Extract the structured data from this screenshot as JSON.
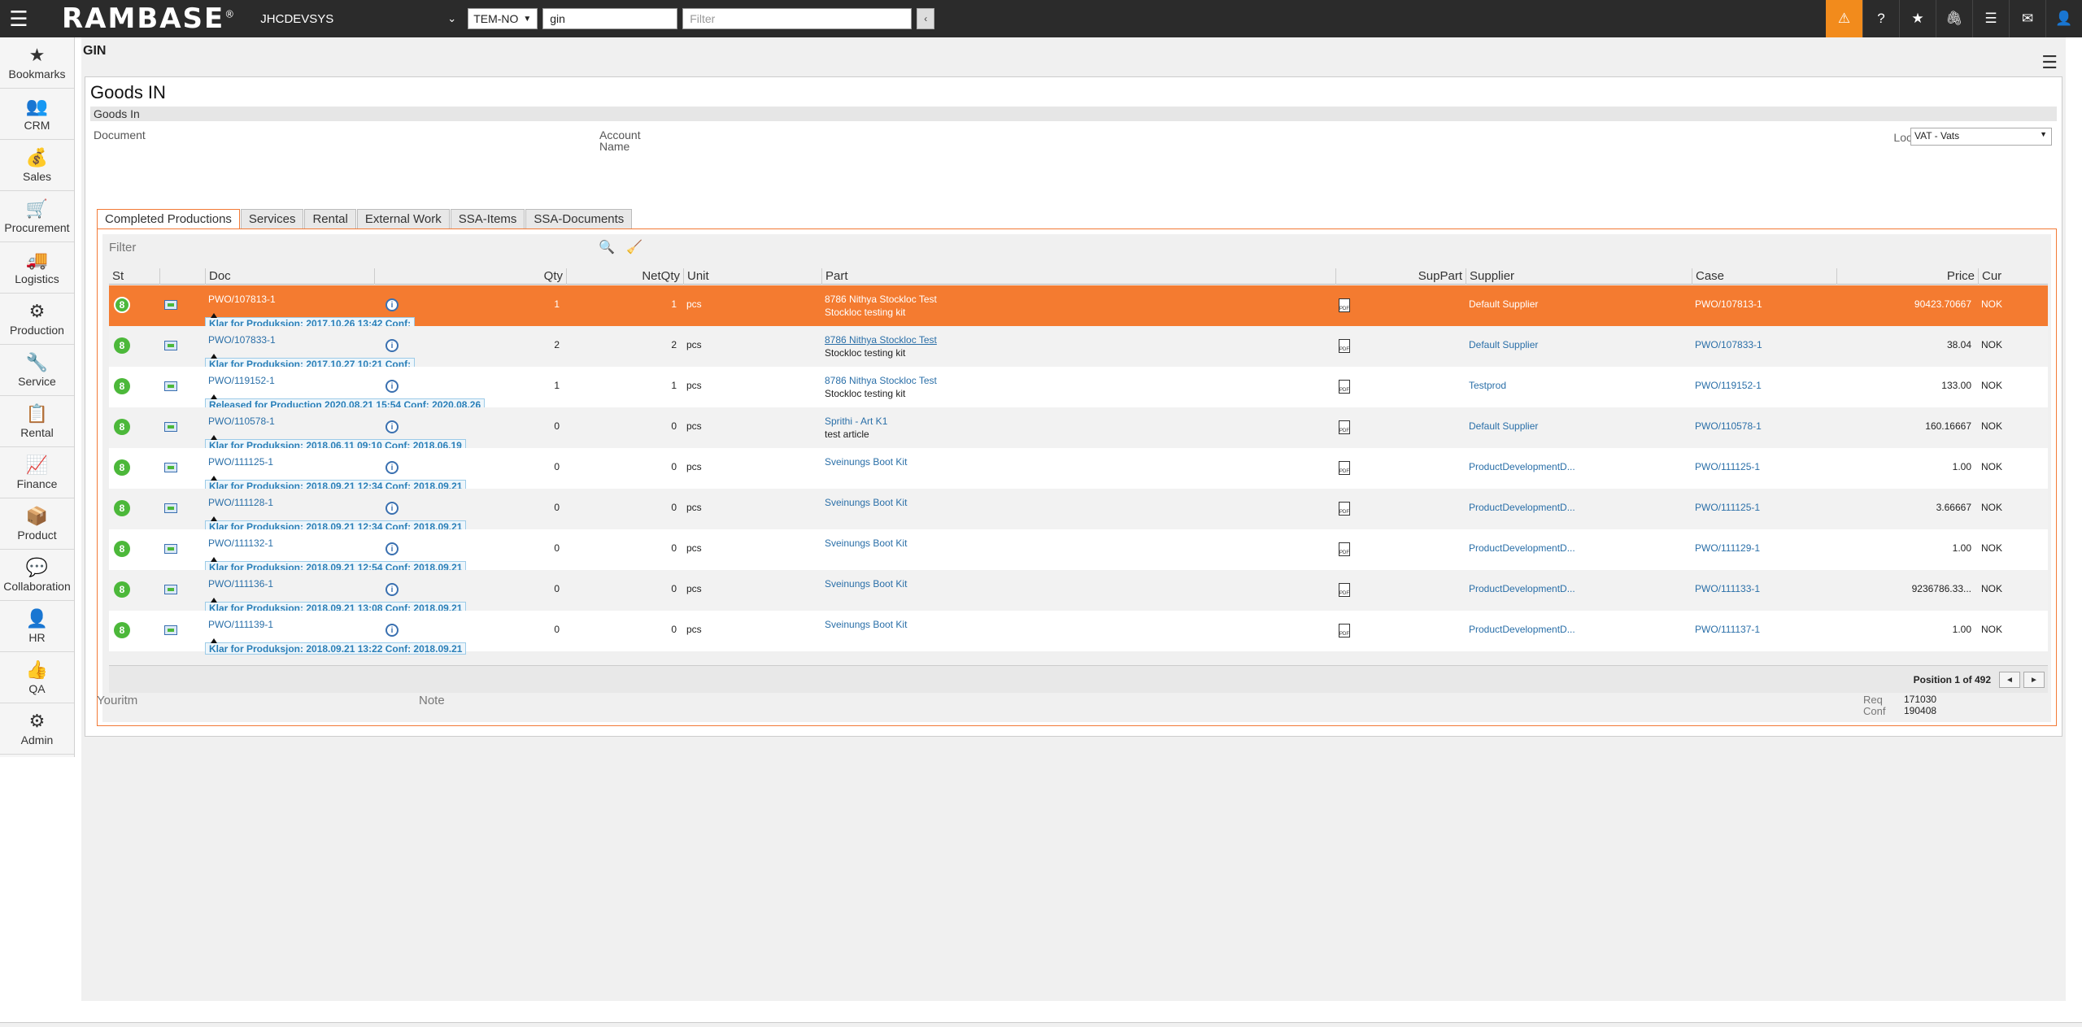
{
  "topbar": {
    "logo": "RAMBASE",
    "logo_mark": "®",
    "company": "JHCDEVSYS",
    "company_arrow": "⌄",
    "company_code": "TEM-NO",
    "program_value": "gin",
    "filter_placeholder": "Filter",
    "collapse_btn": "‹",
    "icons": [
      "warning-icon",
      "help-icon",
      "star-icon",
      "paperclip-icon",
      "list-icon",
      "mail-icon",
      "user-icon"
    ]
  },
  "sidebar": {
    "items": [
      {
        "label": "Bookmarks",
        "icon": "★"
      },
      {
        "label": "CRM",
        "icon": "👥"
      },
      {
        "label": "Sales",
        "icon": "💰"
      },
      {
        "label": "Procurement",
        "icon": "🛒"
      },
      {
        "label": "Logistics",
        "icon": "🚚"
      },
      {
        "label": "Production",
        "icon": "⚙"
      },
      {
        "label": "Service",
        "icon": "🔧"
      },
      {
        "label": "Rental",
        "icon": "📋"
      },
      {
        "label": "Finance",
        "icon": "📈"
      },
      {
        "label": "Product",
        "icon": "📦"
      },
      {
        "label": "Collaboration",
        "icon": "💬"
      },
      {
        "label": "HR",
        "icon": "👤"
      },
      {
        "label": "QA",
        "icon": "👍"
      },
      {
        "label": "Admin",
        "icon": "⚙"
      }
    ]
  },
  "page": {
    "title": "GIN",
    "card_title": "Goods IN",
    "section": "Goods In",
    "fields": {
      "document": "Document",
      "account_name_1": "Account",
      "account_name_2": "Name",
      "loc_label": "Loc",
      "loc_value": "VAT - Vats"
    }
  },
  "tabs": [
    "Completed Productions",
    "Services",
    "Rental",
    "External Work",
    "SSA-Items",
    "SSA-Documents"
  ],
  "grid": {
    "filter_label": "Filter",
    "columns": {
      "st": "St",
      "doc": "Doc",
      "qty": "Qty",
      "netqty": "NetQty",
      "unit": "Unit",
      "part": "Part",
      "suppart": "SupPart",
      "supplier": "Supplier",
      "case": "Case",
      "price": "Price",
      "cur": "Cur"
    },
    "rows": [
      {
        "st": "8",
        "doc": "PWO/107813-1",
        "status": "Klar for Produksjon: 2017.10.26 13:42 Conf:",
        "qty": "1",
        "netqty": "1",
        "unit": "pcs",
        "part1": "8786 Nithya Stockloc Test",
        "part2": "Stockloc testing kit",
        "supplier": "Default Supplier",
        "case": "PWO/107813-1",
        "price": "90423.70667",
        "cur": "NOK"
      },
      {
        "st": "8",
        "doc": "PWO/107833-1",
        "status": "Klar for Produksjon: 2017.10.27 10:21 Conf:",
        "qty": "2",
        "netqty": "2",
        "unit": "pcs",
        "part1": "8786 Nithya Stockloc Test",
        "part2": "Stockloc testing kit",
        "supplier": "Default Supplier",
        "case": "PWO/107833-1",
        "price": "38.04",
        "cur": "NOK"
      },
      {
        "st": "8",
        "doc": "PWO/119152-1",
        "status": "Released for Production 2020.08.21 15:54 Conf: 2020.08.26",
        "qty": "1",
        "netqty": "1",
        "unit": "pcs",
        "part1": "8786 Nithya Stockloc Test",
        "part2": "Stockloc testing kit",
        "supplier": "Testprod",
        "case": "PWO/119152-1",
        "price": "133.00",
        "cur": "NOK"
      },
      {
        "st": "8",
        "doc": "PWO/110578-1",
        "status": "Klar for Produksjon: 2018.06.11 09:10 Conf: 2018.06.19",
        "qty": "0",
        "netqty": "0",
        "unit": "pcs",
        "part1": "Sprithi - Art K1",
        "part2": "test article",
        "supplier": "Default Supplier",
        "case": "PWO/110578-1",
        "price": "160.16667",
        "cur": "NOK"
      },
      {
        "st": "8",
        "doc": "PWO/111125-1",
        "status": "Klar for Produksjon: 2018.09.21 12:34 Conf: 2018.09.21",
        "qty": "0",
        "netqty": "0",
        "unit": "pcs",
        "part1": "Sveinungs Boot Kit",
        "part2": "",
        "supplier": "ProductDevelopmentD...",
        "case": "PWO/111125-1",
        "price": "1.00",
        "cur": "NOK"
      },
      {
        "st": "8",
        "doc": "PWO/111128-1",
        "status": "Klar for Produksjon: 2018.09.21 12:34 Conf: 2018.09.21",
        "qty": "0",
        "netqty": "0",
        "unit": "pcs",
        "part1": "Sveinungs Boot Kit",
        "part2": "",
        "supplier": "ProductDevelopmentD...",
        "case": "PWO/111125-1",
        "price": "3.66667",
        "cur": "NOK"
      },
      {
        "st": "8",
        "doc": "PWO/111132-1",
        "status": "Klar for Produksjon: 2018.09.21 12:54 Conf: 2018.09.21",
        "qty": "0",
        "netqty": "0",
        "unit": "pcs",
        "part1": "Sveinungs Boot Kit",
        "part2": "",
        "supplier": "ProductDevelopmentD...",
        "case": "PWO/111129-1",
        "price": "1.00",
        "cur": "NOK"
      },
      {
        "st": "8",
        "doc": "PWO/111136-1",
        "status": "Klar for Produksjon: 2018.09.21 13:08 Conf: 2018.09.21",
        "qty": "0",
        "netqty": "0",
        "unit": "pcs",
        "part1": "Sveinungs Boot Kit",
        "part2": "",
        "supplier": "ProductDevelopmentD...",
        "case": "PWO/111133-1",
        "price": "9236786.33...",
        "cur": "NOK"
      },
      {
        "st": "8",
        "doc": "PWO/111139-1",
        "status": "Klar for Produksjon: 2018.09.21 13:22 Conf: 2018.09.21",
        "qty": "0",
        "netqty": "0",
        "unit": "pcs",
        "part1": "Sveinungs Boot Kit",
        "part2": "",
        "supplier": "ProductDevelopmentD...",
        "case": "PWO/111137-1",
        "price": "1.00",
        "cur": "NOK"
      }
    ],
    "position": "Position 1 of 492",
    "prev": "◄",
    "next": "►"
  },
  "bottom": {
    "youritm": "Youritm",
    "note": "Note",
    "req_label": "Req",
    "req_value": "171030",
    "conf_label": "Conf",
    "conf_value": "190408"
  }
}
